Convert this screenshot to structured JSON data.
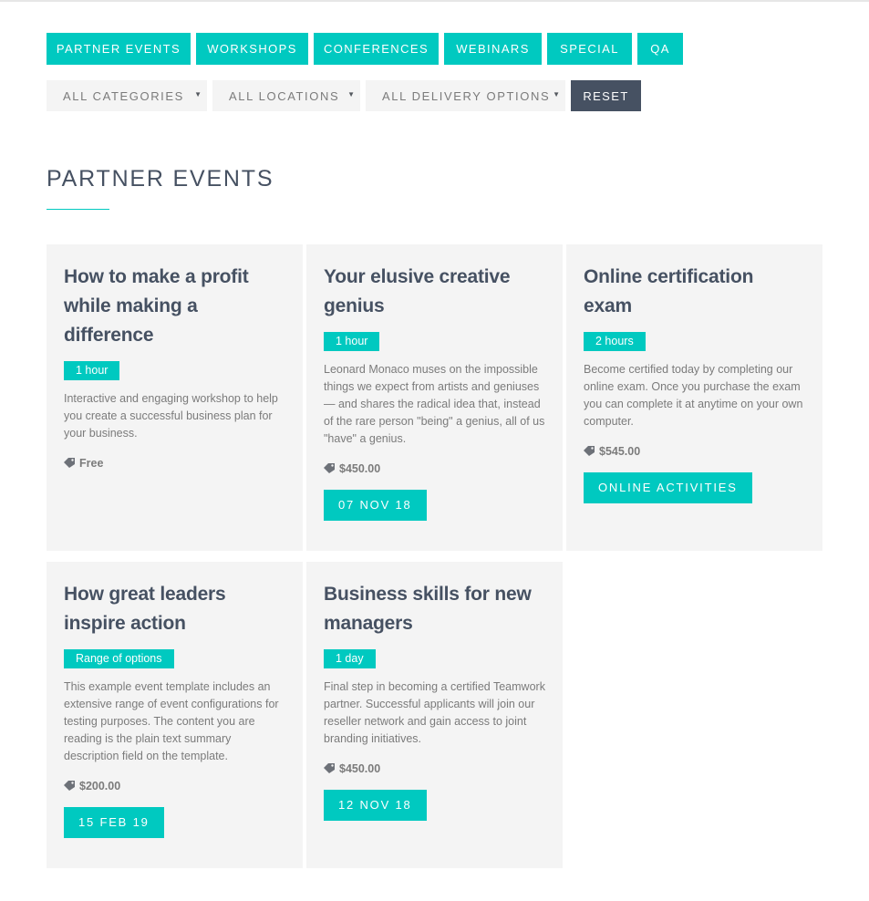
{
  "tabs": [
    "PARTNER EVENTS",
    "WORKSHOPS",
    "CONFERENCES",
    "WEBINARS",
    "SPECIAL",
    "QA"
  ],
  "filters": {
    "categories": "ALL CATEGORIES",
    "locations": "ALL LOCATIONS",
    "delivery": "ALL DELIVERY OPTIONS",
    "reset": "RESET"
  },
  "section_title": "PARTNER EVENTS",
  "events": [
    {
      "title": "How to make a profit while making a difference",
      "duration": "1 hour",
      "description": "Interactive and engaging workshop to help you create a successful business plan for your business.",
      "price": "Free",
      "action": ""
    },
    {
      "title": "Your elusive creative genius",
      "duration": "1 hour",
      "description": "Leonard Monaco muses on the impossible things we expect from artists and geniuses — and shares the radical idea that, instead of the rare person \"being\" a genius, all of us \"have\" a genius.",
      "price": "$450.00",
      "action": "07 NOV 18"
    },
    {
      "title": "Online certification exam",
      "duration": "2 hours",
      "description": "Become certified today by completing our online exam. Once you purchase the exam you can complete it at anytime on your own computer.",
      "price": "$545.00",
      "action": "ONLINE ACTIVITIES"
    },
    {
      "title": "How great leaders inspire action",
      "duration": "Range of options",
      "description": "This example event template includes an extensive range of event configurations for testing purposes. The content you are reading is the plain text summary description field on the template.",
      "price": "$200.00",
      "action": "15 FEB 19"
    },
    {
      "title": "Business skills for new managers",
      "duration": "1 day",
      "description": "Final step in becoming a certified Teamwork partner. Successful applicants will join our reseller network and gain access to joint branding initiatives.",
      "price": "$450.00",
      "action": "12 NOV 18"
    }
  ],
  "colors": {
    "accent": "#00c9c0",
    "heading": "#465162",
    "text": "#7b7b7b",
    "card_bg": "#f4f4f4",
    "reset_bg": "#465162"
  },
  "icons": {
    "caret": "caret-down-icon",
    "price": "price-tag-icon"
  }
}
